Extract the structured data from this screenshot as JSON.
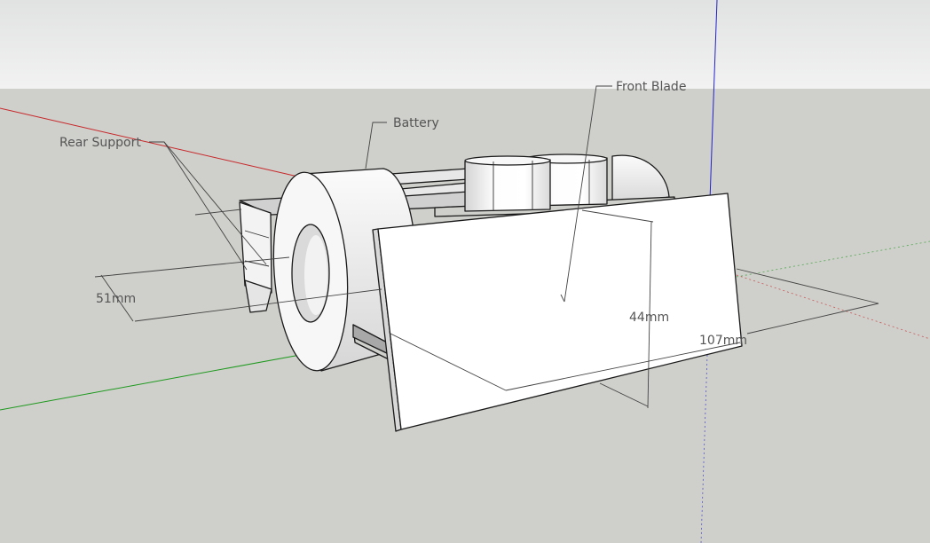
{
  "labels": {
    "rear_support": "Rear Support",
    "battery": "Battery",
    "front_blade": "Front Blade"
  },
  "dimensions": {
    "width": "51mm",
    "height": "44mm",
    "length": "107mm"
  },
  "colors": {
    "sky": "#e9eaea",
    "ground": "#cfcfcb",
    "face_light": "#ffffff",
    "face_shade": "#dedede",
    "axis_red": "#c8282a",
    "axis_green": "#1e9a1e",
    "axis_blue": "#2222cc"
  }
}
